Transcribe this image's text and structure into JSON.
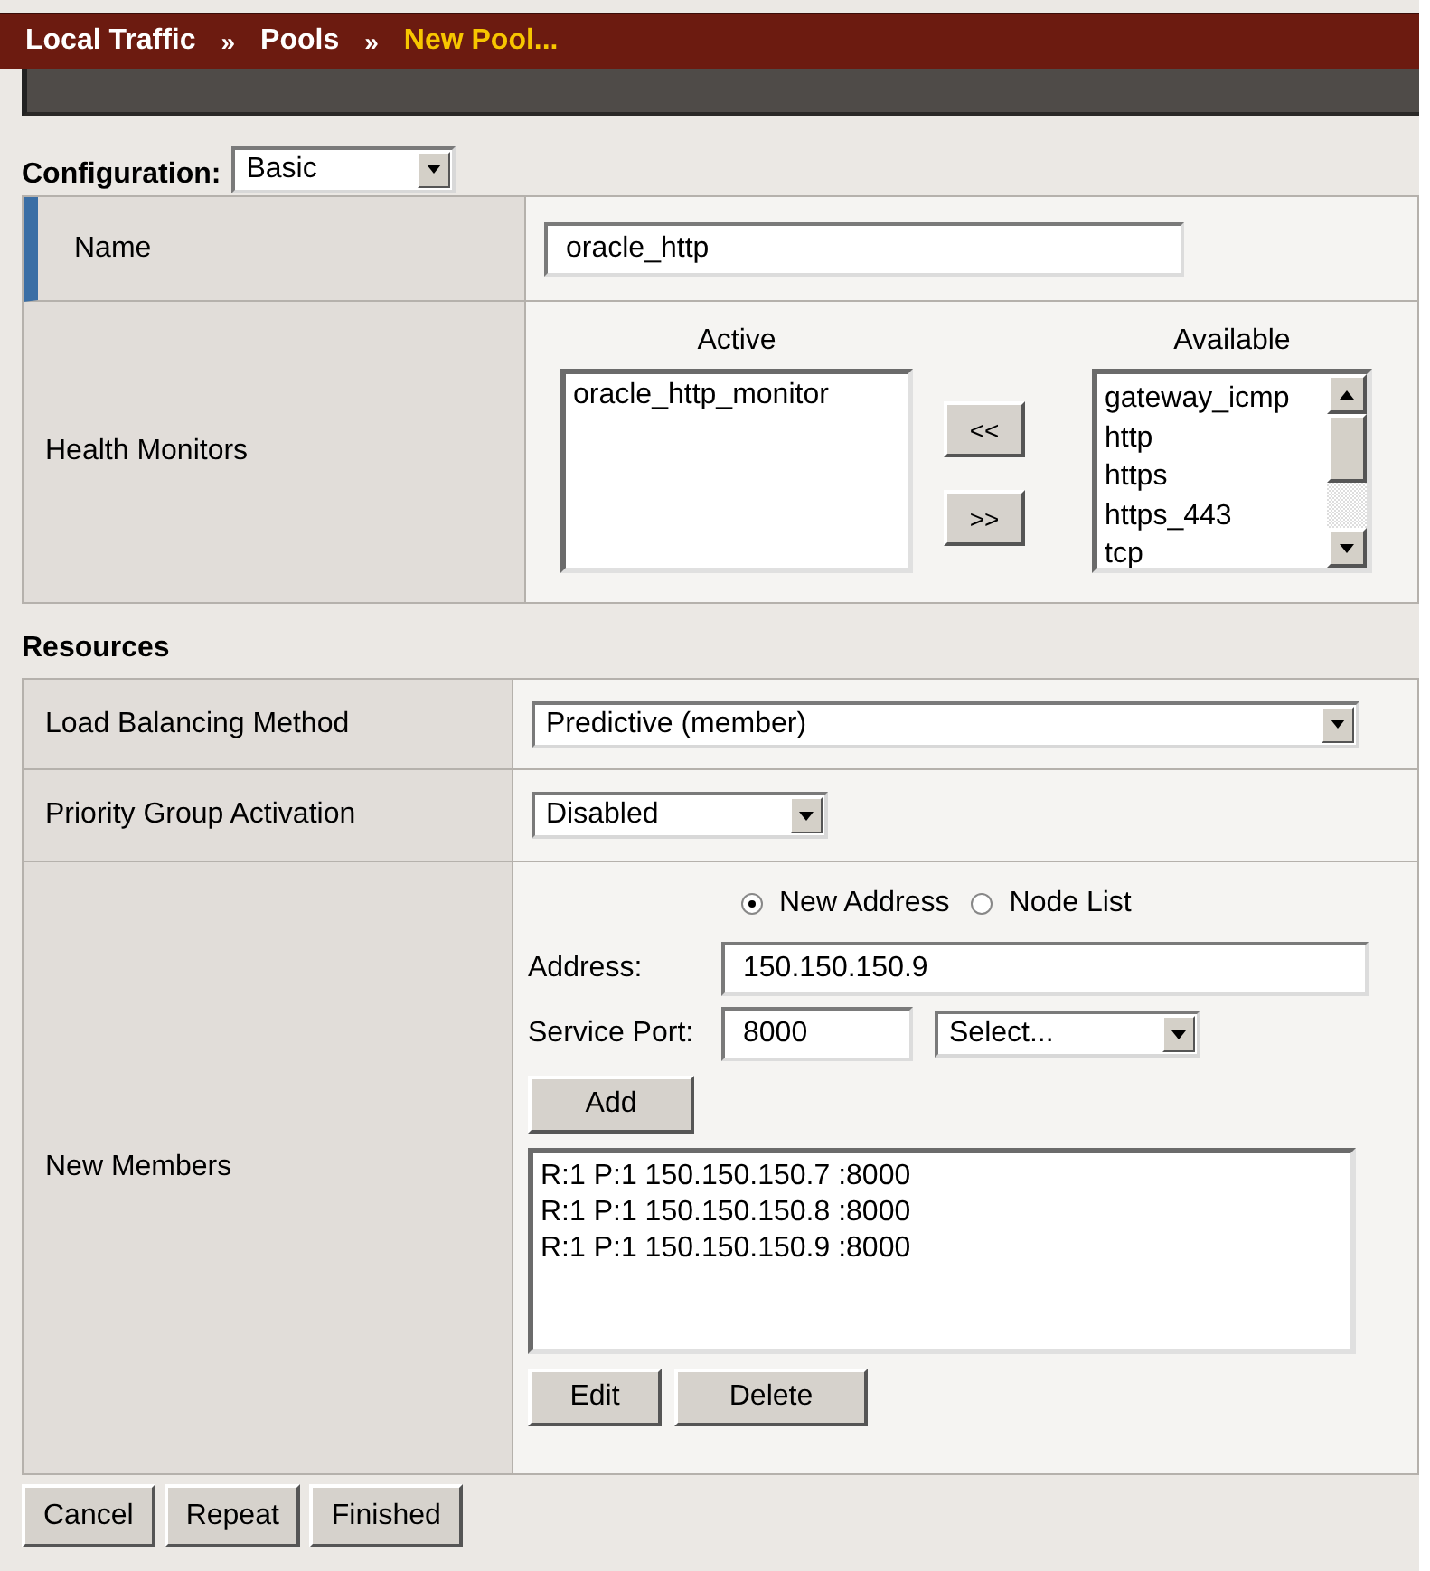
{
  "breadcrumb": [
    {
      "kind": "link",
      "label": "Local Traffic"
    },
    {
      "kind": "separator",
      "label": "»"
    },
    {
      "kind": "link",
      "label": "Pools"
    },
    {
      "kind": "separator",
      "label": "»"
    },
    {
      "kind": "current",
      "label": "New Pool..."
    }
  ],
  "configuration": {
    "label": "Configuration:",
    "value": "Basic"
  },
  "name_row": {
    "label": "Name",
    "value": "oracle_http",
    "required": true
  },
  "health_monitors": {
    "label": "Health Monitors",
    "active_heading": "Active",
    "active": [
      "oracle_http_monitor"
    ],
    "move_buttons": [
      "<<",
      ">>"
    ],
    "available_heading": "Available",
    "available": [
      "gateway_icmp",
      "http",
      "https",
      "https_443",
      "tcp"
    ]
  },
  "resources": {
    "heading": "Resources",
    "load_balancing": {
      "label": "Load Balancing Method",
      "value": "Predictive (member)"
    },
    "priority_group": {
      "label": "Priority Group Activation",
      "value": "Disabled"
    },
    "new_members": {
      "label": "New Members",
      "radios": [
        {
          "label": "New Address",
          "selected": true
        },
        {
          "label": "Node List",
          "selected": false
        }
      ],
      "address_label": "Address:",
      "address": "150.150.150.9",
      "port_label": "Service Port:",
      "port": "8000",
      "service": "Select...",
      "add_button": "Add",
      "members": [
        "R:1 P:1 150.150.150.7 :8000",
        "R:1 P:1 150.150.150.8 :8000",
        "R:1 P:1 150.150.150.9 :8000"
      ],
      "member_buttons": [
        "Edit",
        "Delete"
      ]
    }
  },
  "footer_buttons": [
    "Cancel",
    "Repeat",
    "Finished"
  ]
}
